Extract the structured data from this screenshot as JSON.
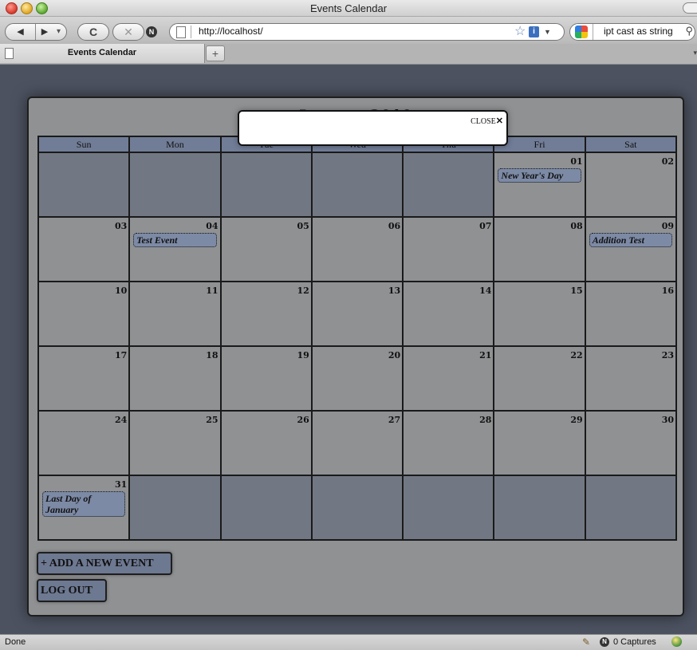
{
  "window": {
    "title": "Events Calendar"
  },
  "toolbar": {
    "back_icon": "back-arrow",
    "forward_icon": "forward-arrow",
    "reload_glyph": "C",
    "stop_glyph": "✕",
    "url": "http://localhost/",
    "search_text": "ipt cast as string"
  },
  "tabs": [
    {
      "label": "Events Calendar"
    }
  ],
  "newtab_label": "+",
  "calendar": {
    "title": "January 2010",
    "weekdays": [
      "Sun",
      "Mon",
      "Tue",
      "Wed",
      "Thu",
      "Fri",
      "Sat"
    ],
    "weeks": [
      [
        {
          "day": "",
          "fill": true
        },
        {
          "day": "",
          "fill": true
        },
        {
          "day": "",
          "fill": true
        },
        {
          "day": "",
          "fill": true
        },
        {
          "day": "",
          "fill": true
        },
        {
          "day": "01",
          "events": [
            "New Year's Day"
          ]
        },
        {
          "day": "02"
        }
      ],
      [
        {
          "day": "03"
        },
        {
          "day": "04",
          "events": [
            "Test Event"
          ]
        },
        {
          "day": "05"
        },
        {
          "day": "06"
        },
        {
          "day": "07"
        },
        {
          "day": "08"
        },
        {
          "day": "09",
          "events": [
            "Addition Test"
          ]
        }
      ],
      [
        {
          "day": "10"
        },
        {
          "day": "11"
        },
        {
          "day": "12"
        },
        {
          "day": "13"
        },
        {
          "day": "14"
        },
        {
          "day": "15"
        },
        {
          "day": "16"
        }
      ],
      [
        {
          "day": "17"
        },
        {
          "day": "18"
        },
        {
          "day": "19"
        },
        {
          "day": "20"
        },
        {
          "day": "21"
        },
        {
          "day": "22"
        },
        {
          "day": "23"
        }
      ],
      [
        {
          "day": "24"
        },
        {
          "day": "25"
        },
        {
          "day": "26"
        },
        {
          "day": "27"
        },
        {
          "day": "28"
        },
        {
          "day": "29"
        },
        {
          "day": "30"
        }
      ],
      [
        {
          "day": "31",
          "events": [
            "Last Day of January"
          ]
        },
        {
          "day": "",
          "fill": true
        },
        {
          "day": "",
          "fill": true
        },
        {
          "day": "",
          "fill": true
        },
        {
          "day": "",
          "fill": true
        },
        {
          "day": "",
          "fill": true
        },
        {
          "day": "",
          "fill": true
        }
      ]
    ]
  },
  "buttons": {
    "add_event": "+ ADD A NEW EVENT",
    "logout": "LOG OUT"
  },
  "modal": {
    "close_label": "CLOSE",
    "close_glyph": "✕"
  },
  "status": {
    "text": "Done",
    "captures": "0 Captures"
  },
  "colors": {
    "page_bg": "#4c5260",
    "panel_bg": "#8f9193",
    "header_bg": "#717d97",
    "event_bg": "#7d8aa5",
    "filler_cell": "#727883"
  }
}
